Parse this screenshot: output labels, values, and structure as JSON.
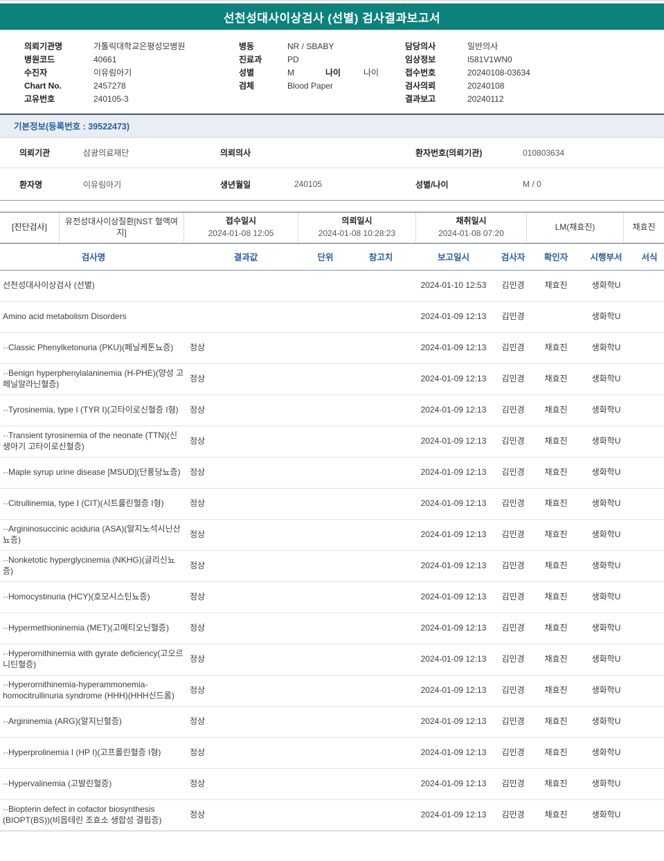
{
  "title": "선천성대사이상검사 (선별) 검사결과보고서",
  "patient_header": {
    "left": [
      {
        "label": "의뢰기관명",
        "value": "가톨릭대학교은평성모병원"
      },
      {
        "label": "병원코드",
        "value": "40661"
      },
      {
        "label": "수진자",
        "value": "이유림아기"
      },
      {
        "label": "Chart No.",
        "value": "2457278"
      },
      {
        "label": "고유번호",
        "value": "240105-3"
      }
    ],
    "middle": [
      {
        "label": "병동",
        "value": "NR / SBABY"
      },
      {
        "label": "진료과",
        "value": "PD"
      },
      {
        "label": "성별",
        "value": "M",
        "label2": "나이",
        "value2": "나이"
      },
      {
        "label": "검체",
        "value": "Blood Paper"
      }
    ],
    "right": [
      {
        "label": "담당의사",
        "value": "일반의사"
      },
      {
        "label": "임상정보",
        "value": "I581V1WN0"
      },
      {
        "label": "접수번호",
        "value": "20240108-03634"
      },
      {
        "label": "검사의뢰",
        "value": "20240108"
      },
      {
        "label": "결과보고",
        "value": "20240112"
      }
    ]
  },
  "basic_info": {
    "title": "기본정보(등록번호 : 39522473)",
    "row1": {
      "l1": "의뢰기관",
      "v1": "삼광의료재단",
      "l2": "의뢰의사",
      "v2": "",
      "l3": "환자번호(의뢰기관)",
      "v3": "010803634"
    },
    "row2": {
      "l1": "환자명",
      "v1": "이유림아기",
      "l2": "생년월일",
      "v2": "240105",
      "l3": "성별/나이",
      "v3": "M / 0"
    }
  },
  "exam_info": {
    "category": "[진단검사]",
    "name": "유전성대사이상질환[NST 혈액여지]",
    "receipt_label": "접수일시",
    "receipt_value": "2024-01-08 12:05",
    "request_label": "의뢰일시",
    "request_value": "2024-01-08 10:28:23",
    "collection_label": "채취일시",
    "collection_value": "2024-01-08 07:20",
    "collector": "LM(채효진)",
    "confirmer": "채효진"
  },
  "results_table": {
    "headers": [
      "검사명",
      "결과값",
      "단위",
      "참고치",
      "보고일시",
      "검사자",
      "확인자",
      "시행부서",
      "서식"
    ],
    "rows": [
      {
        "name": "선천성대사이상검사 (선별)",
        "result": "",
        "unit": "",
        "ref": "",
        "reported": "2024-01-10 12:53",
        "tester": "김민경",
        "confirmer": "채효진",
        "dept": "생화학U",
        "format": ""
      },
      {
        "name": "Amino acid metabolism Disorders",
        "result": "",
        "unit": "",
        "ref": "",
        "reported": "2024-01-09 12:13",
        "tester": "김민경",
        "confirmer": "",
        "dept": "생화학U",
        "format": ""
      },
      {
        "name": "··Classic Phenylketonuria (PKU)(페닐케톤뇨증)",
        "result": "정상",
        "unit": "",
        "ref": "",
        "reported": "2024-01-09 12:13",
        "tester": "김민경",
        "confirmer": "채효진",
        "dept": "생화학U",
        "format": ""
      },
      {
        "name": "··Benign hyperphenylalaninemia (H-PHE)(양성 고페닐알라닌혈증)",
        "result": "정상",
        "unit": "",
        "ref": "",
        "reported": "2024-01-09 12:13",
        "tester": "김민경",
        "confirmer": "채효진",
        "dept": "생화학U",
        "format": ""
      },
      {
        "name": "··Tyrosinemia, type I (TYR I)(고타이로신혈증 I형)",
        "result": "정상",
        "unit": "",
        "ref": "",
        "reported": "2024-01-09 12:13",
        "tester": "김민경",
        "confirmer": "채효진",
        "dept": "생화학U",
        "format": ""
      },
      {
        "name": "··Transient tyrosinemia of the neonate (TTN)(신생아기 고타이로신혈증)",
        "result": "정상",
        "unit": "",
        "ref": "",
        "reported": "2024-01-09 12:13",
        "tester": "김민경",
        "confirmer": "채효진",
        "dept": "생화학U",
        "format": ""
      },
      {
        "name": "··Maple syrup urine disease [MSUD](단풍당뇨증)",
        "result": "정상",
        "unit": "",
        "ref": "",
        "reported": "2024-01-09 12:13",
        "tester": "김민경",
        "confirmer": "채효진",
        "dept": "생화학U",
        "format": ""
      },
      {
        "name": "··Citrullinemia, type I (CIT)(시트룰린혈증 I형)",
        "result": "정상",
        "unit": "",
        "ref": "",
        "reported": "2024-01-09 12:13",
        "tester": "김민경",
        "confirmer": "채효진",
        "dept": "생화학U",
        "format": ""
      },
      {
        "name": "··Argininosuccinic aciduria (ASA)(알지노석시닌산뇨증)",
        "result": "정상",
        "unit": "",
        "ref": "",
        "reported": "2024-01-09 12:13",
        "tester": "김민경",
        "confirmer": "채효진",
        "dept": "생화학U",
        "format": ""
      },
      {
        "name": "··Nonketotic hyperglycinemia (NKHG)(글리신뇨증)",
        "result": "정상",
        "unit": "",
        "ref": "",
        "reported": "2024-01-09 12:13",
        "tester": "김민경",
        "confirmer": "채효진",
        "dept": "생화학U",
        "format": ""
      },
      {
        "name": "··Homocystinuria (HCY)(호모시스틴뇨증)",
        "result": "정상",
        "unit": "",
        "ref": "",
        "reported": "2024-01-09 12:13",
        "tester": "김민경",
        "confirmer": "채효진",
        "dept": "생화학U",
        "format": ""
      },
      {
        "name": "··Hypermethioninemia (MET)(고메티오닌혈증)",
        "result": "정상",
        "unit": "",
        "ref": "",
        "reported": "2024-01-09 12:13",
        "tester": "김민경",
        "confirmer": "채효진",
        "dept": "생화학U",
        "format": ""
      },
      {
        "name": "··Hyperornithinemia with gyrate deficiency(고오르니틴혈증)",
        "result": "정상",
        "unit": "",
        "ref": "",
        "reported": "2024-01-09 12:13",
        "tester": "김민경",
        "confirmer": "채효진",
        "dept": "생화학U",
        "format": ""
      },
      {
        "name": "··Hyperornithinemia-hyperammonemia-homocitrullinuria syndrome (HHH)(HHH신드롬)",
        "result": "정상",
        "unit": "",
        "ref": "",
        "reported": "2024-01-09 12:13",
        "tester": "김민경",
        "confirmer": "채효진",
        "dept": "생화학U",
        "format": ""
      },
      {
        "name": "··Argininemia (ARG)(알지닌혈증)",
        "result": "정상",
        "unit": "",
        "ref": "",
        "reported": "2024-01-09 12:13",
        "tester": "김민경",
        "confirmer": "채효진",
        "dept": "생화학U",
        "format": ""
      },
      {
        "name": "··Hyperprolinemia I (HP I)(고프롤린혈증 I형)",
        "result": "정상",
        "unit": "",
        "ref": "",
        "reported": "2024-01-09 12:13",
        "tester": "김민경",
        "confirmer": "채효진",
        "dept": "생화학U",
        "format": ""
      },
      {
        "name": "··Hypervalinemia (고발린혈증)",
        "result": "정상",
        "unit": "",
        "ref": "",
        "reported": "2024-01-09 12:13",
        "tester": "김민경",
        "confirmer": "채효진",
        "dept": "생화학U",
        "format": ""
      },
      {
        "name": "··Biopterin defect in cofactor biosynthesis (BIOPT(BS))(비옵테린 조효소 생합성 결핍증)",
        "result": "정상",
        "unit": "",
        "ref": "",
        "reported": "2024-01-09 12:13",
        "tester": "김민경",
        "confirmer": "채효진",
        "dept": "생화학U",
        "format": ""
      }
    ]
  }
}
